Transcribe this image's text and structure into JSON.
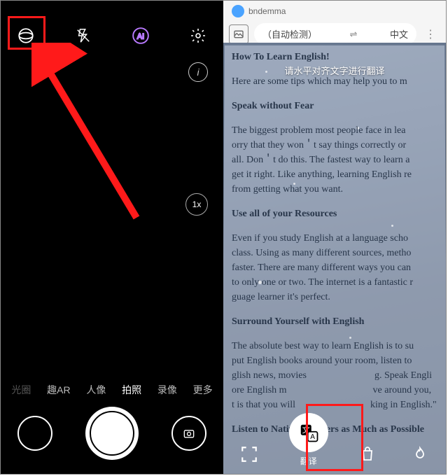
{
  "camera": {
    "zoom_label": "1x",
    "info_label": "i",
    "modes": [
      "光圈",
      "趣AR",
      "人像",
      "拍照",
      "录像",
      "更多"
    ],
    "active_mode_index": 3
  },
  "translate_ui": {
    "username": "bndemma",
    "lang_from": "（自动检测）",
    "lang_to": "中文",
    "swap": "⇌",
    "hint": "请水平对齐文字进行翻译",
    "translate_label": "翻译"
  },
  "document": {
    "title": "How To Learn English!",
    "p1": "Here are some tips which may help you to m",
    "h2": "Speak without Fear",
    "p2a": "The biggest problem most people face in lea",
    "p2b": "orry that they won＇t say things correctly or",
    "p2c": "all. Don＇t do this. The fastest way to learn a",
    "p2d": "get it right. Like anything, learning English re",
    "p2e": "from getting what you want.",
    "h3": "Use all of your Resources",
    "p3a": "Even if you study English at a language scho",
    "p3b": "class. Using as many different sources, metho",
    "p3c": "faster. There are many different ways you can",
    "p3d": "to only one or two. The internet is a fantastic r",
    "p3e": "guage learner it's perfect.",
    "h4": "Surround Yourself with English",
    "p4a": "The absolute best way to learn English is to su",
    "p4b": "put English books around your room, listen to",
    "p4c": "glish news, movies",
    "p4d": "ore English m",
    "p4e": "t is that you will",
    "p4cR": "g. Speak Engli",
    "p4dR": "ve around you,",
    "p4eR": "king in English.\"",
    "h5": "Listen to Native Speakers as Much as Possible"
  }
}
